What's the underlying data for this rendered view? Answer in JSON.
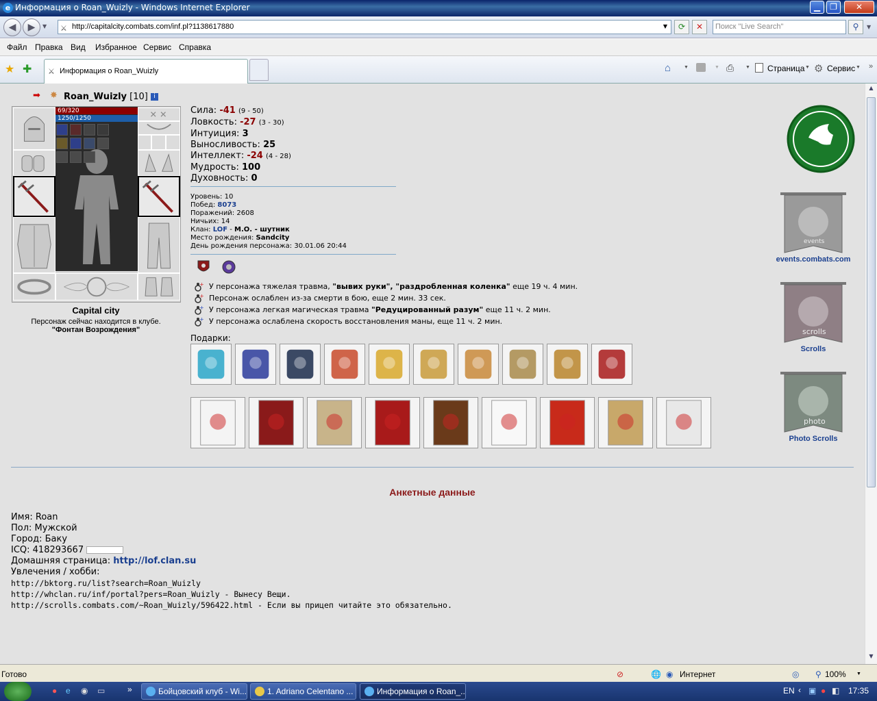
{
  "window": {
    "title": "Информация о Roan_Wuizly - Windows Internet Explorer"
  },
  "address": {
    "url": "http://capitalcity.combats.com/inf.pl?1138617880",
    "search_placeholder": "Поиск \"Live Search\""
  },
  "menu": [
    "Файл",
    "Правка",
    "Вид",
    "Избранное",
    "Сервис",
    "Справка"
  ],
  "tab": {
    "title": "Информация о Roan_Wuizly"
  },
  "toolbar": {
    "page_label": "Страница",
    "tools_label": "Сервис"
  },
  "character": {
    "name": "Roan_Wuizly",
    "level_tag": "[10]",
    "hp": "69/320",
    "mana": "1250/1250",
    "city": "Capital city",
    "location_text": "Персонаж сейчас находится в клубе.",
    "location_place": "\"Фонтан Возрождения\""
  },
  "stats": [
    {
      "label": "Сила:",
      "value": "-41",
      "range": "(9 - 50)",
      "neg": true
    },
    {
      "label": "Ловкость:",
      "value": "-27",
      "range": "(3 - 30)",
      "neg": true
    },
    {
      "label": "Интуиция:",
      "value": "3",
      "range": "",
      "neg": false
    },
    {
      "label": "Выносливость:",
      "value": "25",
      "range": "",
      "neg": false
    },
    {
      "label": "Интеллект:",
      "value": "-24",
      "range": "(4 - 28)",
      "neg": true
    },
    {
      "label": "Мудрость:",
      "value": "100",
      "range": "",
      "neg": false
    },
    {
      "label": "Духовность:",
      "value": "0",
      "range": "",
      "neg": false
    }
  ],
  "info": {
    "level": "Уровень: 10",
    "wins_label": "Побед: ",
    "wins": "8073",
    "losses": "Поражений: 2608",
    "draws": "Ничьих: 14",
    "clan_label": "Клан: ",
    "clan": "LOF",
    "clan_sep": " - ",
    "clan_rank": "М.О. - шутник",
    "birth_place_label": "Место рождения: ",
    "birth_place": "Sandcity",
    "birthday": "День рождения персонажа: 30.01.06 20:44"
  },
  "traumas": [
    {
      "pre": "У персонажа тяжелая травма, ",
      "bold": "\"вывих руки\", \"раздробленная коленка\"",
      "post": " еще 19 ч. 4 мин."
    },
    {
      "pre": "Персонаж ослаблен из-за смерти в бою, еще 2 мин. 33 сек.",
      "bold": "",
      "post": ""
    },
    {
      "pre": "У персонажа легкая магическая травма ",
      "bold": "\"Редуцированный разум\"",
      "post": " еще 11 ч. 2 мин."
    },
    {
      "pre": "У персонажа ослаблена скорость восстановления маны, еще 11 ч. 2 мин.",
      "bold": "",
      "post": ""
    }
  ],
  "gifts": {
    "label": "Подарки:"
  },
  "profile": {
    "section_title": "Анкетные данные",
    "name": "Имя: Roan",
    "gender": "Пол: Мужской",
    "city": "Город: Баку",
    "icq": "ICQ: 418293667",
    "homepage_label": "Домашняя страница: ",
    "homepage": "http://lof.clan.su",
    "hobby_label": "Увлечения / хобби:",
    "hobby_lines": [
      "http://bktorg.ru/list?search=Roan_Wuizly",
      "http://whclan.ru/inf/portal?pers=Roan_Wuizly  - Вынесу Вещи.",
      "http://scrolls.combats.com/~Roan_Wuizly/596422.html - Если вы прицеп читайте это обязательно."
    ]
  },
  "right_links": [
    {
      "label": "events.combats.com"
    },
    {
      "label": "Scrolls"
    },
    {
      "label": "Photo Scrolls"
    }
  ],
  "status": {
    "text": "Готово",
    "zone": "Интернет",
    "zoom": "100%"
  },
  "taskbar": {
    "items": [
      "Бойцовский клуб - Wi...",
      "1. Adriano Celentano ...",
      "Информация о Roan_..."
    ],
    "lang": "EN",
    "time": "17:35"
  }
}
